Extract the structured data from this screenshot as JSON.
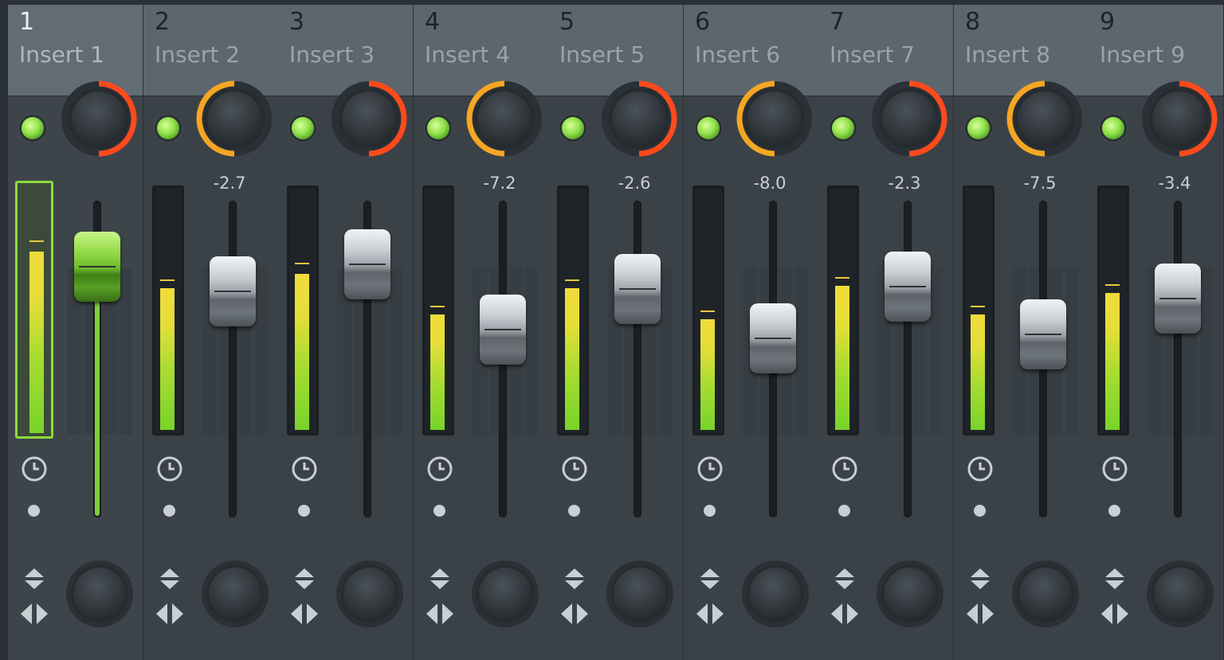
{
  "colors": {
    "background": "#2b3136",
    "header": "#5c666e",
    "led": "#8fe04a",
    "pan_orange": "#f5a623",
    "pan_red": "#ff4a1c",
    "meter_green": "#78d42a",
    "meter_yellow": "#f0dc3a",
    "selected_outline": "#8ddc3c"
  },
  "icons": {
    "send": "clock-icon",
    "route": "dot-icon",
    "swap": "up-down-arrows-icon",
    "stereo": "stereo-separation-icon"
  },
  "strips": [
    {
      "number": "1",
      "name": "Insert 1",
      "volume_label": "",
      "selected": true,
      "pan_side": "right",
      "meter_level": 0.73,
      "peak_level": 0.77,
      "fader_level": 0.89
    },
    {
      "number": "2",
      "name": "Insert 2",
      "volume_label": "-2.7",
      "selected": false,
      "pan_side": "left",
      "meter_level": 0.59,
      "peak_level": 0.62,
      "fader_level": 0.78
    },
    {
      "number": "3",
      "name": "Insert 3",
      "volume_label": "",
      "selected": false,
      "pan_side": "right",
      "meter_level": 0.65,
      "peak_level": 0.69,
      "fader_level": 0.9
    },
    {
      "number": "4",
      "name": "Insert 4",
      "volume_label": "-7.2",
      "selected": false,
      "pan_side": "left",
      "meter_level": 0.48,
      "peak_level": 0.51,
      "fader_level": 0.61
    },
    {
      "number": "5",
      "name": "Insert 5",
      "volume_label": "-2.6",
      "selected": false,
      "pan_side": "right",
      "meter_level": 0.59,
      "peak_level": 0.62,
      "fader_level": 0.79
    },
    {
      "number": "6",
      "name": "Insert 6",
      "volume_label": "-8.0",
      "selected": false,
      "pan_side": "left",
      "meter_level": 0.46,
      "peak_level": 0.49,
      "fader_level": 0.57
    },
    {
      "number": "7",
      "name": "Insert 7",
      "volume_label": "-2.3",
      "selected": false,
      "pan_side": "right",
      "meter_level": 0.6,
      "peak_level": 0.63,
      "fader_level": 0.8
    },
    {
      "number": "8",
      "name": "Insert 8",
      "volume_label": "-7.5",
      "selected": false,
      "pan_side": "left",
      "meter_level": 0.48,
      "peak_level": 0.51,
      "fader_level": 0.59
    },
    {
      "number": "9",
      "name": "Insert 9",
      "volume_label": "-3.4",
      "selected": false,
      "pan_side": "right",
      "meter_level": 0.57,
      "peak_level": 0.6,
      "fader_level": 0.75
    }
  ]
}
